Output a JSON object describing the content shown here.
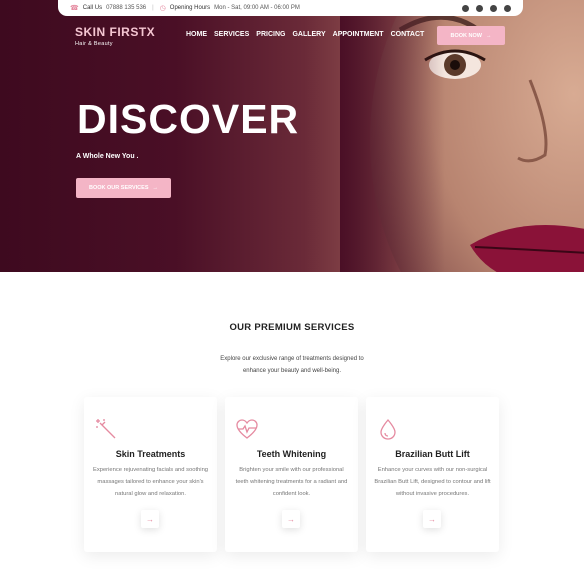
{
  "topbar": {
    "call_label": "Call Us",
    "phone": "07888 135 536",
    "hours_label": "Opening Hours",
    "hours": "Mon - Sat, 09:00 AM - 06:00 PM",
    "social_icons": [
      "facebook-icon",
      "twitter-icon",
      "youtube-icon",
      "instagram-icon"
    ]
  },
  "brand": {
    "name": "SKIN FIRSTX",
    "tagline": "Hair & Beauty"
  },
  "nav": {
    "items": [
      "HOME",
      "SERVICES",
      "PRICING",
      "GALLERY",
      "APPOINTMENT",
      "CONTACT"
    ],
    "book_label": "BOOK NOW"
  },
  "hero": {
    "title": "DISCOVER",
    "subtitle": "A Whole New You .",
    "button_label": "BOOK OUR SERVICES"
  },
  "services": {
    "title": "OUR PREMIUM SERVICES",
    "description": "Explore our exclusive range of treatments designed to enhance your beauty and well-being.",
    "cards": [
      {
        "icon": "magic-wand-icon",
        "title": "Skin Treatments",
        "text": "Experience rejuvenating facials and soothing massages tailored to enhance your skin's natural glow and relaxation."
      },
      {
        "icon": "heartbeat-icon",
        "title": "Teeth Whitening",
        "text": "Brighten your smile with our professional teeth whitening treatments for a radiant and confident look."
      },
      {
        "icon": "drop-icon",
        "title": "Brazilian Butt Lift",
        "text": "Enhance your curves with our non-surgical Brazilian Butt Lift, designed to contour and lift without invasive procedures."
      }
    ]
  },
  "colors": {
    "accent": "#f4b5c6",
    "hero_dark": "#3e0a1f",
    "icon_pink": "#e58aa0"
  }
}
